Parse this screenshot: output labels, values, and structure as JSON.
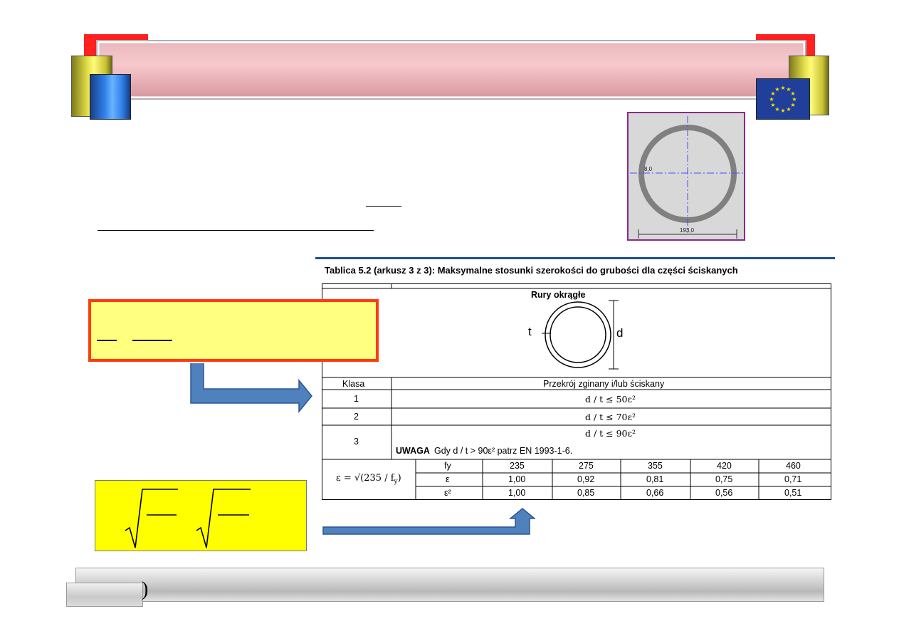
{
  "figure": {
    "dim_small": "8,0",
    "dim_diameter": "193,0"
  },
  "table": {
    "title": "Tablica 5.2 (arkusz 3 z 3): Maksymalne stosunki szerokości do grubości dla części  ściskanych",
    "section_title": "Rury okrągłe",
    "label_t": "t",
    "label_d": "d",
    "header_class": "Klasa",
    "header_desc": "Przekrój zginany i/lub ściskany",
    "rows": [
      {
        "klasa": "1",
        "formula": "d / t ≤ 50ε²"
      },
      {
        "klasa": "2",
        "formula": "d / t ≤ 70ε²"
      },
      {
        "klasa": "3",
        "formula": "d / t ≤ 90ε²"
      }
    ],
    "note_label": "UWAGA",
    "note_text": "Gdy d / t > 90ε² patrz EN 1993-1-6.",
    "eps_formula": "ε = √(235 / f",
    "eps_sub": "y",
    "eps_close": ")",
    "eps_row_labels": [
      "fy",
      "ε",
      "ε²"
    ],
    "fy_values": [
      "235",
      "275",
      "355",
      "420",
      "460"
    ],
    "eps_values": [
      "1,00",
      "0,92",
      "0,81",
      "0,75",
      "0,71"
    ],
    "eps2_values": [
      "1,00",
      "0,85",
      "0,66",
      "0,56",
      "0,51"
    ]
  },
  "bottom_tab_paren": ")",
  "colors": {
    "banner_pink": "#f2c0c5",
    "banner_red": "#ff2020",
    "formula_box_yellow": "#ffff80",
    "formula_box_border": "#ff3b10",
    "arrow_blue": "#4f81bd",
    "figure_border": "#8a2a8a"
  }
}
